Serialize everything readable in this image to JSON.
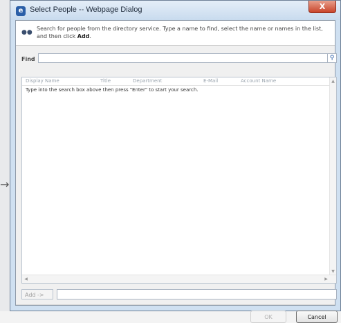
{
  "window": {
    "title": "Select People -- Webpage Dialog",
    "close_glyph": "X",
    "icon": "ie-icon"
  },
  "header": {
    "icon": "people-icon",
    "instructions_text": "Search for people from the directory service. Type a name to find, select the name or names in the list, and then click ",
    "instructions_bold": "Add",
    "instructions_end": "."
  },
  "find": {
    "label": "Find",
    "value": "",
    "placeholder": "",
    "search_icon": "search-icon"
  },
  "results": {
    "columns": [
      "Display Name",
      "Title",
      "Department",
      "E-Mail",
      "Account Name"
    ],
    "hint": "Type into the search box above then press \"Enter\" to start your search."
  },
  "add": {
    "button_label": "Add ->",
    "value": ""
  },
  "footer": {
    "ok_label": "OK",
    "cancel_label": "Cancel"
  }
}
